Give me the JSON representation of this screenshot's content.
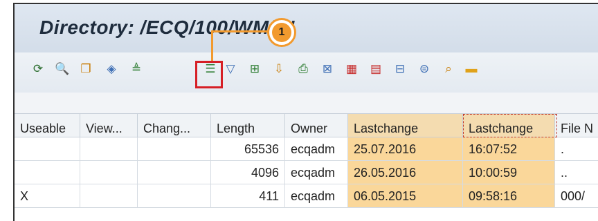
{
  "window": {
    "title": "Directory: /ECQ/100/WM/IN"
  },
  "annotation": {
    "step": "1",
    "color": "#f29a2e",
    "highlight_color": "#d61f26"
  },
  "toolbar": {
    "icons": [
      {
        "name": "refresh-icon",
        "glyph": "⟳",
        "color": "#2c6e2f"
      },
      {
        "name": "find-icon",
        "glyph": "🔍",
        "color": "#2c6e2f"
      },
      {
        "name": "copy-icon",
        "glyph": "❐",
        "color": "#c77a00"
      },
      {
        "name": "layout-icon",
        "glyph": "◈",
        "color": "#3f6fb5"
      },
      {
        "name": "sort-ascending-icon",
        "glyph": "≜",
        "color": "#2e7d32"
      },
      {
        "name": "sort-descending-icon",
        "glyph": "☰",
        "color": "#2e7d32"
      },
      {
        "name": "filter-icon",
        "glyph": "▽",
        "color": "#3f6fb5"
      },
      {
        "name": "total-icon",
        "glyph": "⊞",
        "color": "#2e7d32"
      },
      {
        "name": "subtotal-icon",
        "glyph": "⇩",
        "color": "#c77a00"
      },
      {
        "name": "print-icon",
        "glyph": "⎙",
        "color": "#2e7d32"
      },
      {
        "name": "export-icon",
        "glyph": "⊠",
        "color": "#3f6fb5"
      },
      {
        "name": "spreadsheet-icon",
        "glyph": "▦",
        "color": "#c62828"
      },
      {
        "name": "word-processing-icon",
        "glyph": "▤",
        "color": "#c62828"
      },
      {
        "name": "local-file-icon",
        "glyph": "⊟",
        "color": "#3f6fb5"
      },
      {
        "name": "send-icon",
        "glyph": "⊜",
        "color": "#3f6fb5"
      },
      {
        "name": "abc-analysis-icon",
        "glyph": "⌕",
        "color": "#c77a00"
      },
      {
        "name": "folder-icon",
        "glyph": "▬",
        "color": "#e0a21a"
      }
    ]
  },
  "table": {
    "columns": [
      "Useable",
      "View...",
      "Chang...",
      "Length",
      "Owner",
      "Lastchange",
      "Lastchange",
      "File N"
    ],
    "rows": [
      [
        "",
        "",
        "",
        "65536",
        "ecqadm",
        "25.07.2016",
        "16:07:52",
        "."
      ],
      [
        "",
        "",
        "",
        "4096",
        "ecqadm",
        "26.05.2016",
        "10:00:59",
        ".."
      ],
      [
        "X",
        "",
        "",
        "411",
        "ecqadm",
        "06.05.2015",
        "09:58:16",
        "000/"
      ]
    ]
  }
}
